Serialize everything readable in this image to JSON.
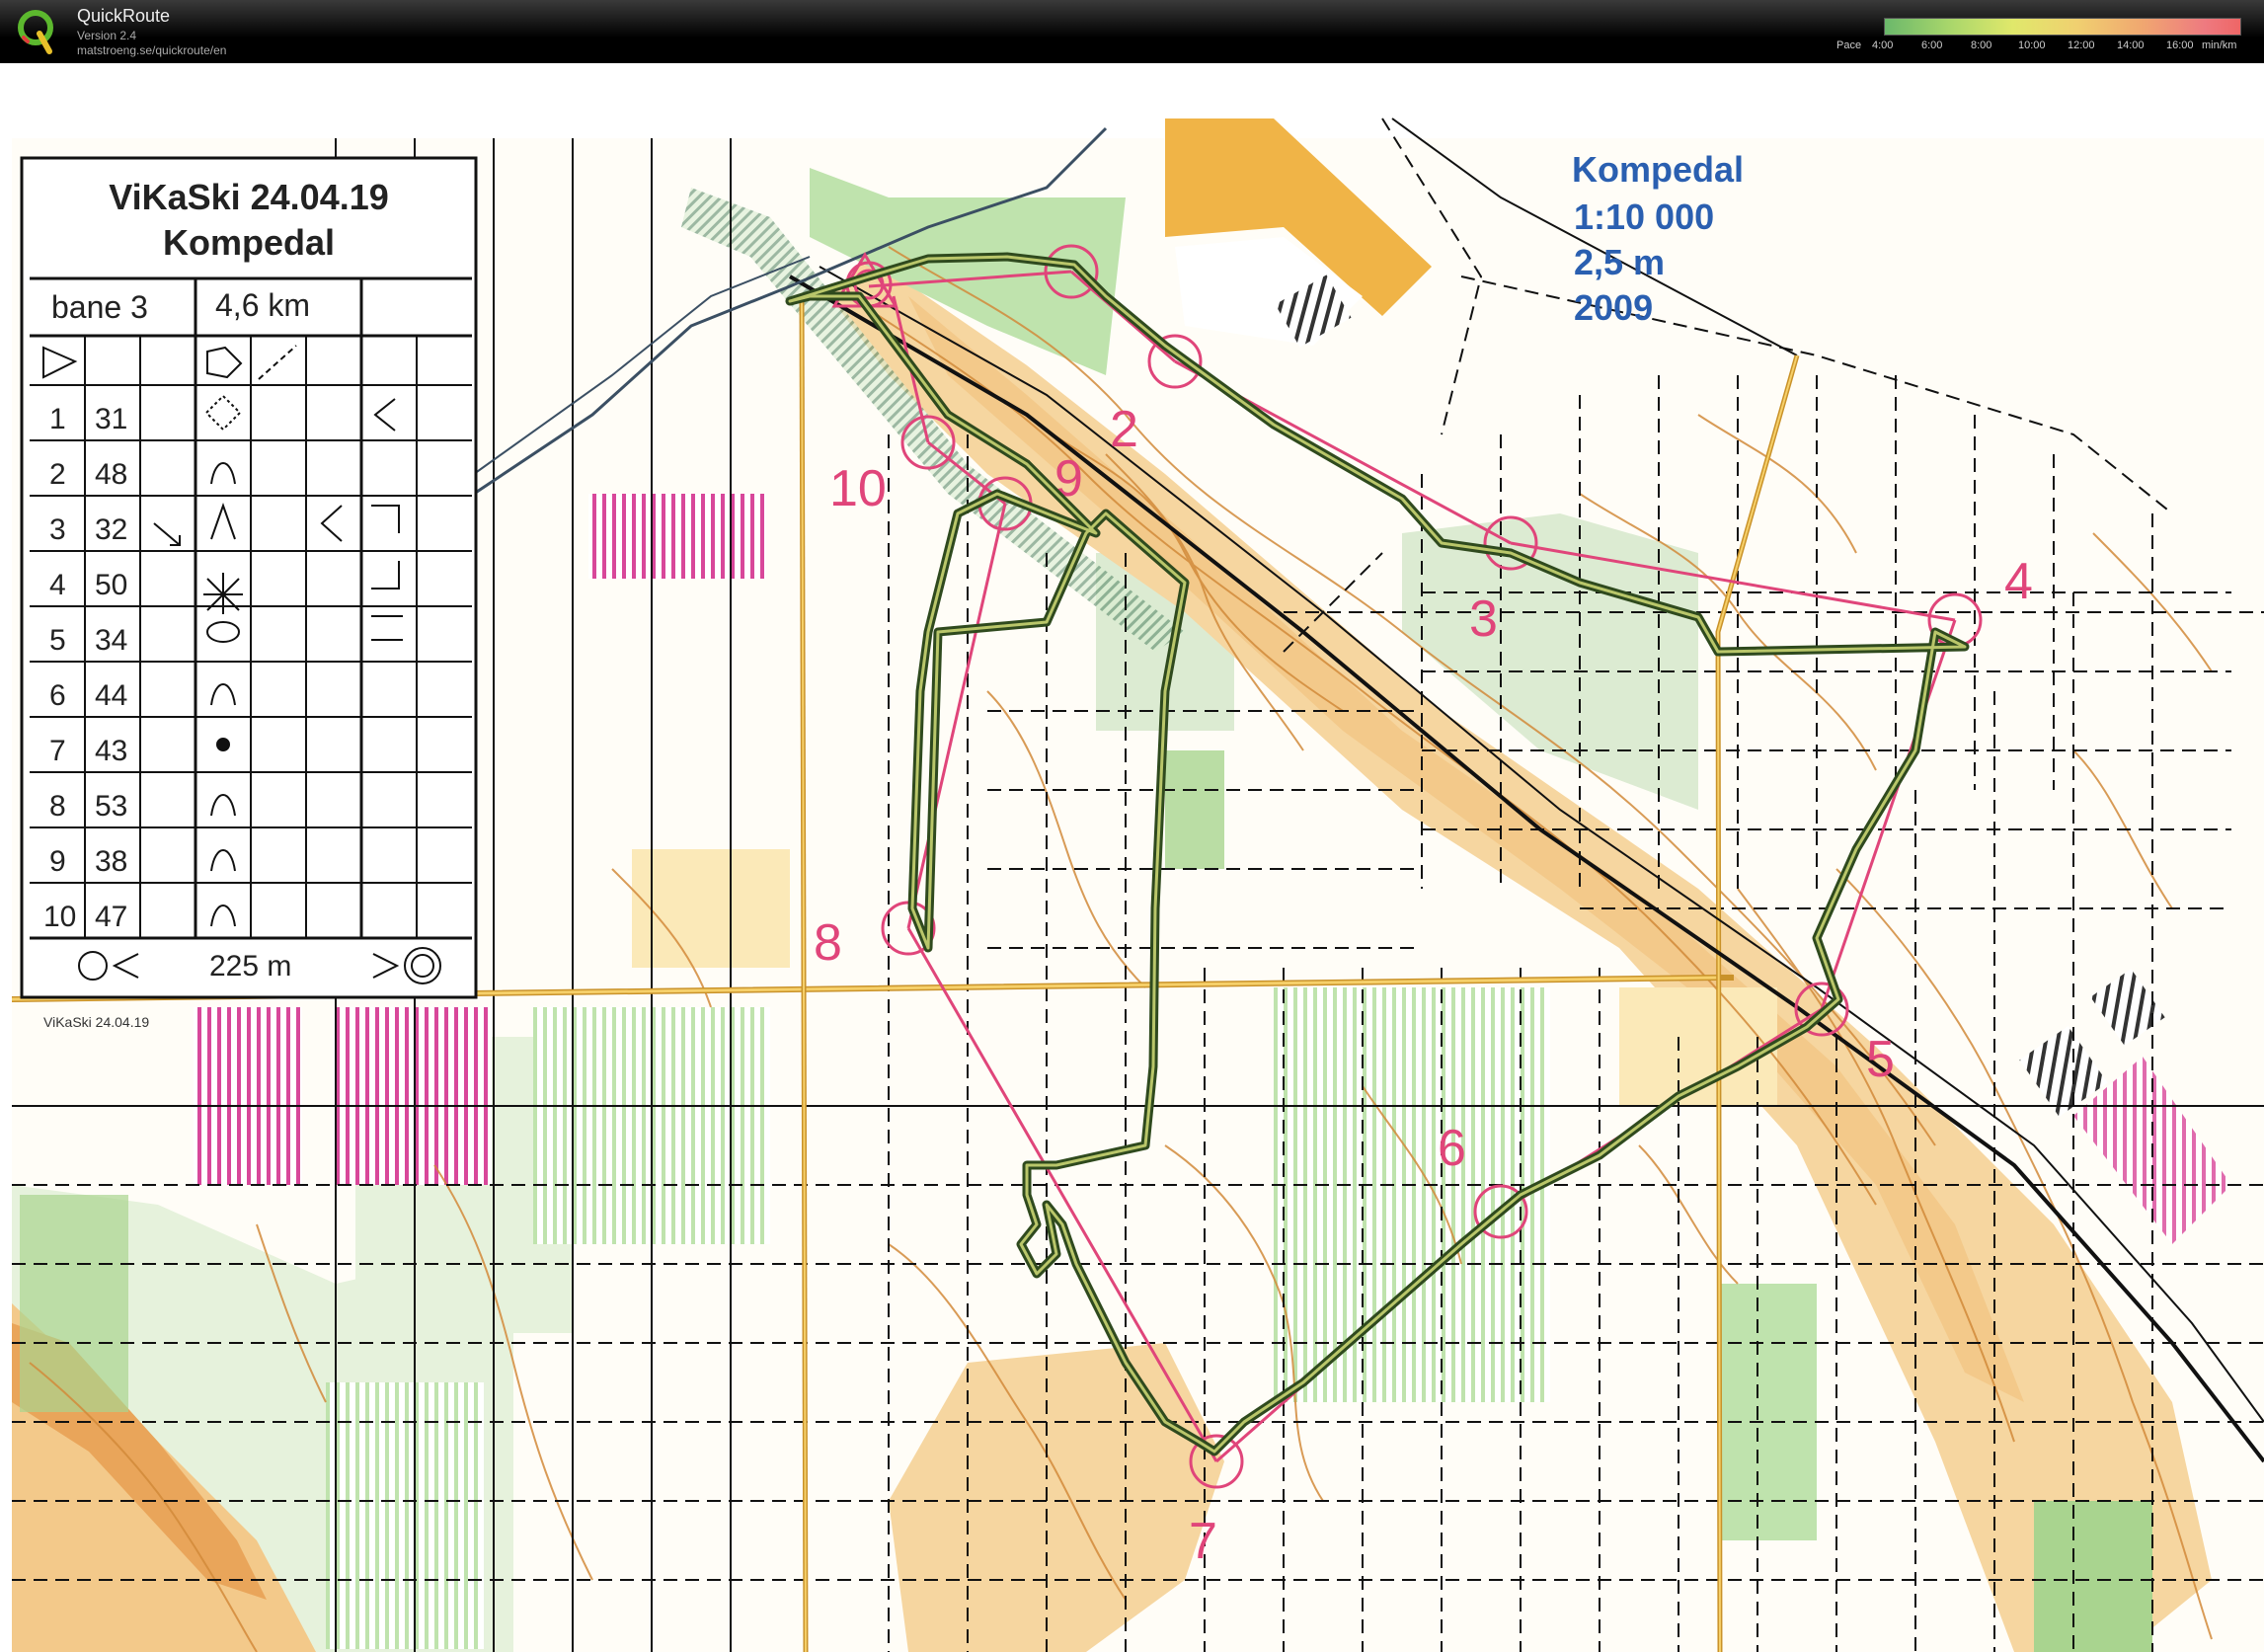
{
  "app": {
    "title": "QuickRoute",
    "version": "Version 2.4",
    "url": "matstroeng.se/quickroute/en"
  },
  "pace_legend": {
    "label": "Pace",
    "ticks": [
      "4:00",
      "6:00",
      "8:00",
      "10:00",
      "12:00",
      "14:00",
      "16:00"
    ],
    "unit": "min/km"
  },
  "map_info": {
    "name": "Kompedal",
    "scale": "1:10 000",
    "contour": "2,5 m",
    "year": "2009"
  },
  "control_card": {
    "title": "ViKaSki 24.04.19",
    "subtitle": "Kompedal",
    "course": "bane 3",
    "length": "4,6 km",
    "rows": [
      {
        "num": "1",
        "code": "31"
      },
      {
        "num": "2",
        "code": "48"
      },
      {
        "num": "3",
        "code": "32"
      },
      {
        "num": "4",
        "code": "50"
      },
      {
        "num": "5",
        "code": "34"
      },
      {
        "num": "6",
        "code": "44"
      },
      {
        "num": "7",
        "code": "43"
      },
      {
        "num": "8",
        "code": "53"
      },
      {
        "num": "9",
        "code": "38"
      },
      {
        "num": "10",
        "code": "47"
      }
    ],
    "finish_distance": "225 m",
    "footer_small": "ViKaSki 24.04.19"
  },
  "controls": [
    "2",
    "3",
    "4",
    "5",
    "6",
    "7",
    "8",
    "9",
    "10"
  ],
  "colors": {
    "course": "#e0457a",
    "route": "#3f5a2a",
    "forest_light": "#cfe6c0",
    "forest": "#a9d48f",
    "open": "#f5d68a",
    "rough_open": "#fbe9b8",
    "contour": "#d28a3a",
    "track": "#222222",
    "info_blue": "#2a5fb0"
  }
}
